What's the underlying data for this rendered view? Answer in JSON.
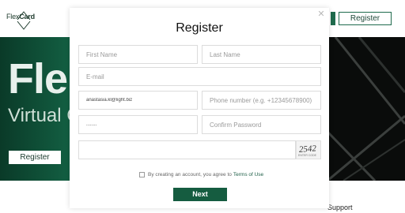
{
  "header": {
    "logo_text_light": "Flex",
    "logo_text_bold": "Card",
    "register_button": "Register"
  },
  "hero": {
    "title": "Fle",
    "subtitle": "Virtual C",
    "register_button": "Register"
  },
  "footer": {
    "support_text": "Support"
  },
  "modal": {
    "title": "Register",
    "close_icon": "close-icon",
    "fields": {
      "first_name": {
        "placeholder": "First Name"
      },
      "last_name": {
        "placeholder": "Last Name"
      },
      "email": {
        "placeholder": "E-mail"
      },
      "email2": {
        "value": "anastasia.kl@light.biz"
      },
      "phone": {
        "placeholder": "Phone number (e.g. +12345678900)"
      },
      "password": {
        "value": "........"
      },
      "confirm_password": {
        "placeholder": "Confirm Password"
      }
    },
    "captcha": {
      "code": "2542",
      "caption": "ENTER CODE"
    },
    "terms": {
      "text": "By creating an account, you agree to",
      "link": "Terms of Use"
    },
    "next_button": "Next"
  },
  "colors": {
    "brand_green": "#155c40",
    "hero_green": "#0e4a34",
    "dark_panel": "#0a0c0b"
  }
}
